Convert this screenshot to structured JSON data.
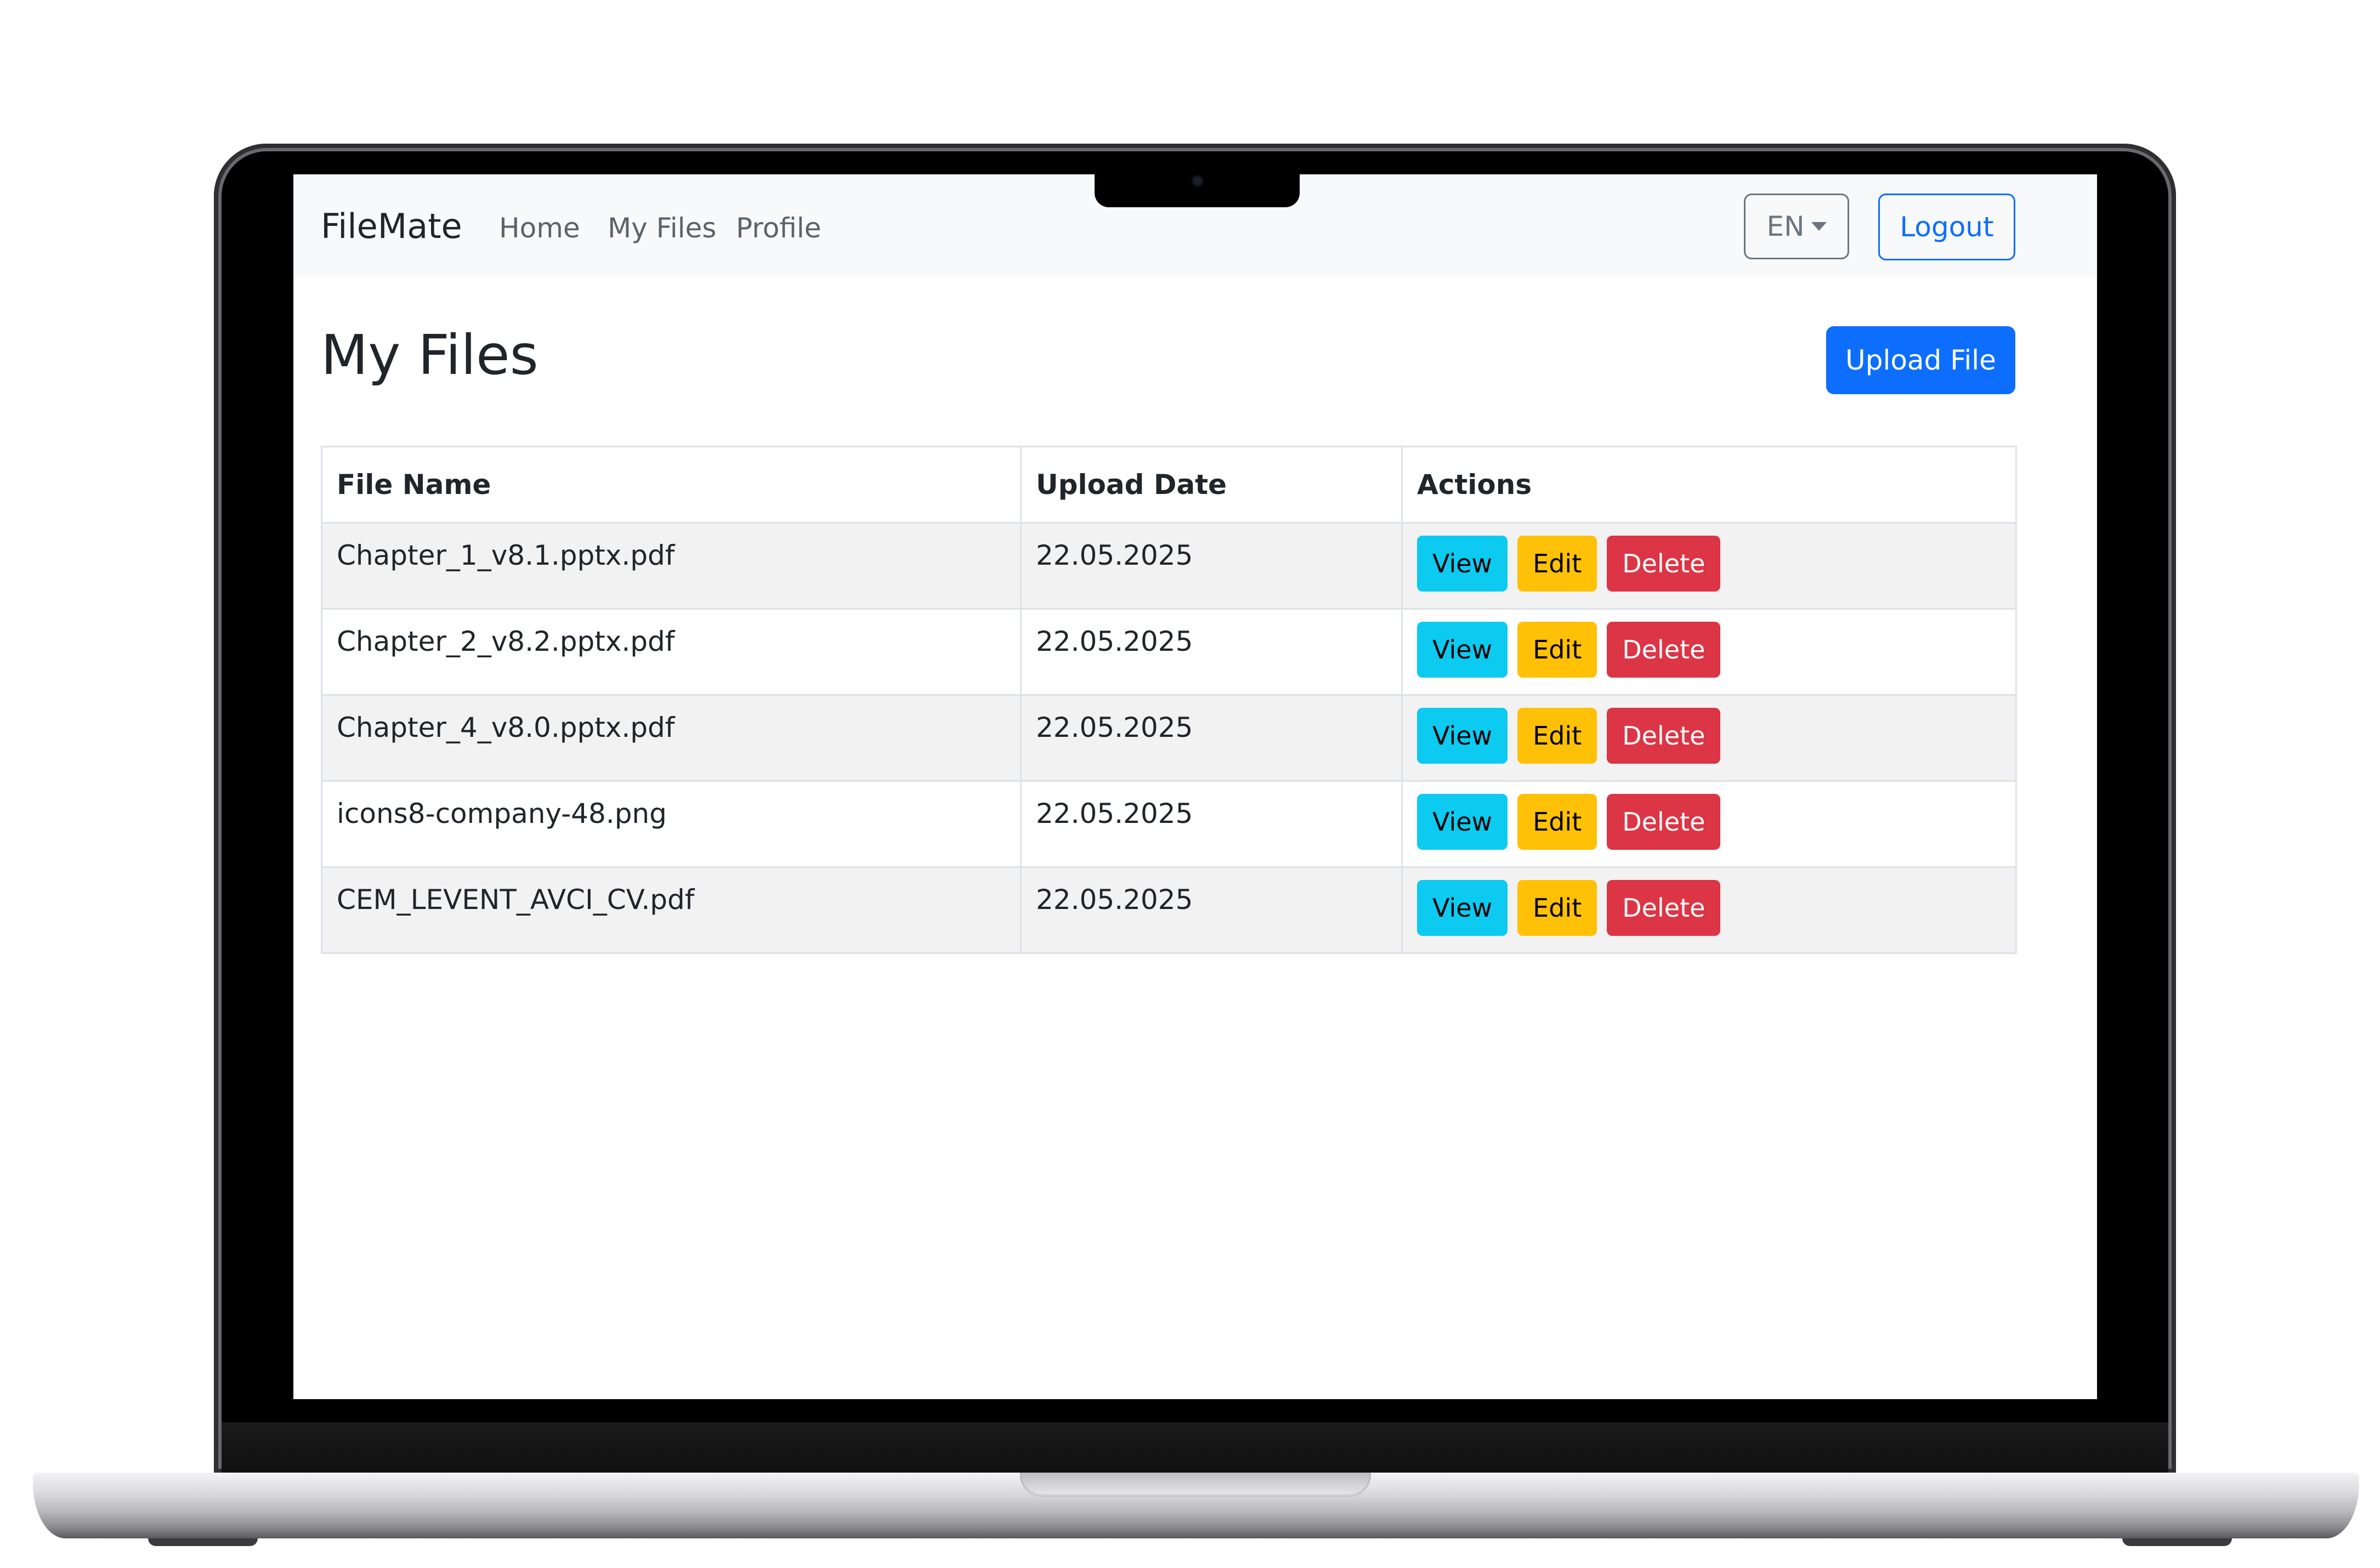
{
  "navbar": {
    "brand": "FileMate",
    "links": [
      "Home",
      "My Files",
      "Profile"
    ],
    "language": "EN",
    "logout_label": "Logout"
  },
  "main": {
    "title": "My Files",
    "upload_label": "Upload File"
  },
  "table": {
    "headers": [
      "File Name",
      "Upload Date",
      "Actions"
    ],
    "rows": [
      {
        "name": "Chapter_1_v8.1.pptx.pdf",
        "date": "22.05.2025"
      },
      {
        "name": "Chapter_2_v8.2.pptx.pdf",
        "date": "22.05.2025"
      },
      {
        "name": "Chapter_4_v8.0.pptx.pdf",
        "date": "22.05.2025"
      },
      {
        "name": "icons8-company-48.png",
        "date": "22.05.2025"
      },
      {
        "name": "CEM_LEVENT_AVCI_CV.pdf",
        "date": "22.05.2025"
      }
    ],
    "actions": {
      "view": "View",
      "edit": "Edit",
      "delete": "Delete"
    }
  },
  "colors": {
    "primary": "#0d6efd",
    "info": "#0dcaf0",
    "warning": "#ffc107",
    "danger": "#dc3545",
    "navbar_bg": "#f8f9fa"
  }
}
